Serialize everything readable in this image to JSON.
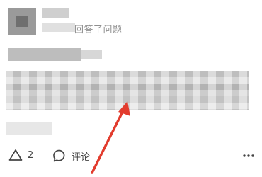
{
  "post": {
    "answered_text": "回答了问题"
  },
  "actions": {
    "like_count": "2",
    "comment_label": "评论"
  },
  "colors": {
    "annotation_arrow": "#e23c2e",
    "icon": "#444444"
  },
  "icons": {
    "like": "triangle-up-icon",
    "comment": "speech-bubble-icon",
    "more": "ellipsis-icon"
  }
}
